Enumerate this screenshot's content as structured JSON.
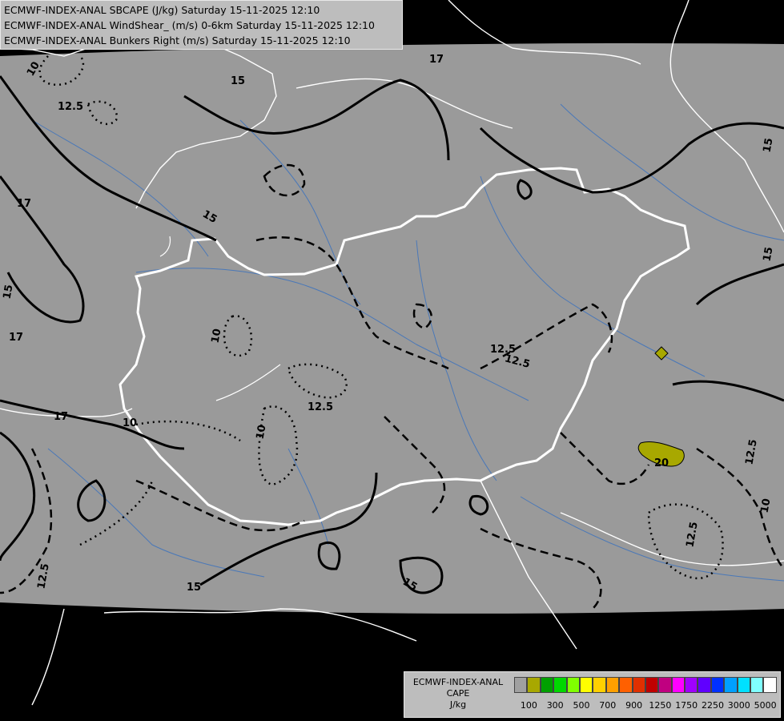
{
  "title": {
    "lines": [
      "ECMWF-INDEX-ANAL SBCAPE (J/kg) Saturday 15-11-2025 12:10",
      "ECMWF-INDEX-ANAL WindShear_ (m/s) 0-6km Saturday 15-11-2025 12:10",
      "ECMWF-INDEX-ANAL Bunkers Right (m/s) Saturday 15-11-2025 12:10"
    ]
  },
  "legend": {
    "model": "ECMWF-INDEX-ANAL",
    "parameter": "CAPE",
    "unit": "J/kg",
    "swatch_colors": [
      "#a0a0a0",
      "#a8a800",
      "#00a000",
      "#00d800",
      "#80ff00",
      "#ffff00",
      "#ffd000",
      "#ffa000",
      "#ff6000",
      "#e03000",
      "#c00000",
      "#c00080",
      "#ff00ff",
      "#a000ff",
      "#6000ff",
      "#0030ff",
      "#00a0ff",
      "#00e0ff",
      "#80ffff",
      "#ffffff"
    ],
    "tick_labels": [
      "100",
      "300",
      "500",
      "700",
      "900",
      "1250",
      "1750",
      "2250",
      "3000",
      "5000"
    ]
  },
  "contour_labels": [
    {
      "text": "10"
    },
    {
      "text": "12.5"
    },
    {
      "text": "15"
    },
    {
      "text": "17"
    },
    {
      "text": "12.5"
    },
    {
      "text": "15"
    },
    {
      "text": "17"
    },
    {
      "text": "15"
    },
    {
      "text": "15"
    },
    {
      "text": "17"
    },
    {
      "text": "15"
    },
    {
      "text": "10"
    },
    {
      "text": "10"
    },
    {
      "text": "12.5"
    },
    {
      "text": "12.5"
    },
    {
      "text": "17"
    },
    {
      "text": "10"
    },
    {
      "text": "12.5"
    },
    {
      "text": "15"
    },
    {
      "text": "15"
    },
    {
      "text": "12.5"
    },
    {
      "text": "10"
    },
    {
      "text": "12.5"
    },
    {
      "text": "20"
    }
  ],
  "colors": {
    "map_domain": "#9a9a9a",
    "outside": "#000000",
    "borders": "#ffffff",
    "rivers": "#4a78b8",
    "contours": "#000000",
    "cape_fill": "#a8a800"
  }
}
